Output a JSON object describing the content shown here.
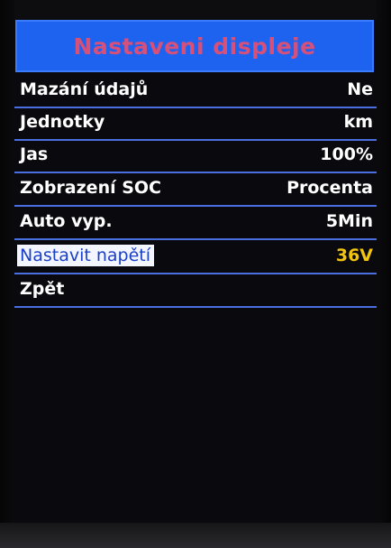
{
  "screen": {
    "title": "Nastaveni displeje",
    "items": [
      {
        "label": "Mazání údajů",
        "value": "Ne",
        "selected": false
      },
      {
        "label": "Jednotky",
        "value": "km",
        "selected": false
      },
      {
        "label": "Jas",
        "value": "100%",
        "selected": false
      },
      {
        "label": "Zobrazení SOC",
        "value": "Procenta",
        "selected": false
      },
      {
        "label": "Auto vyp.",
        "value": "5Min",
        "selected": false
      },
      {
        "label": "Nastavit napětí",
        "value": "36V",
        "selected": true
      },
      {
        "label": "Zpět",
        "value": "",
        "selected": false
      }
    ]
  },
  "colors": {
    "title_bar": "#1e63f0",
    "title_text": "#d6517a",
    "divider": "#4a6fe0",
    "selected_value": "#f2c40f"
  }
}
